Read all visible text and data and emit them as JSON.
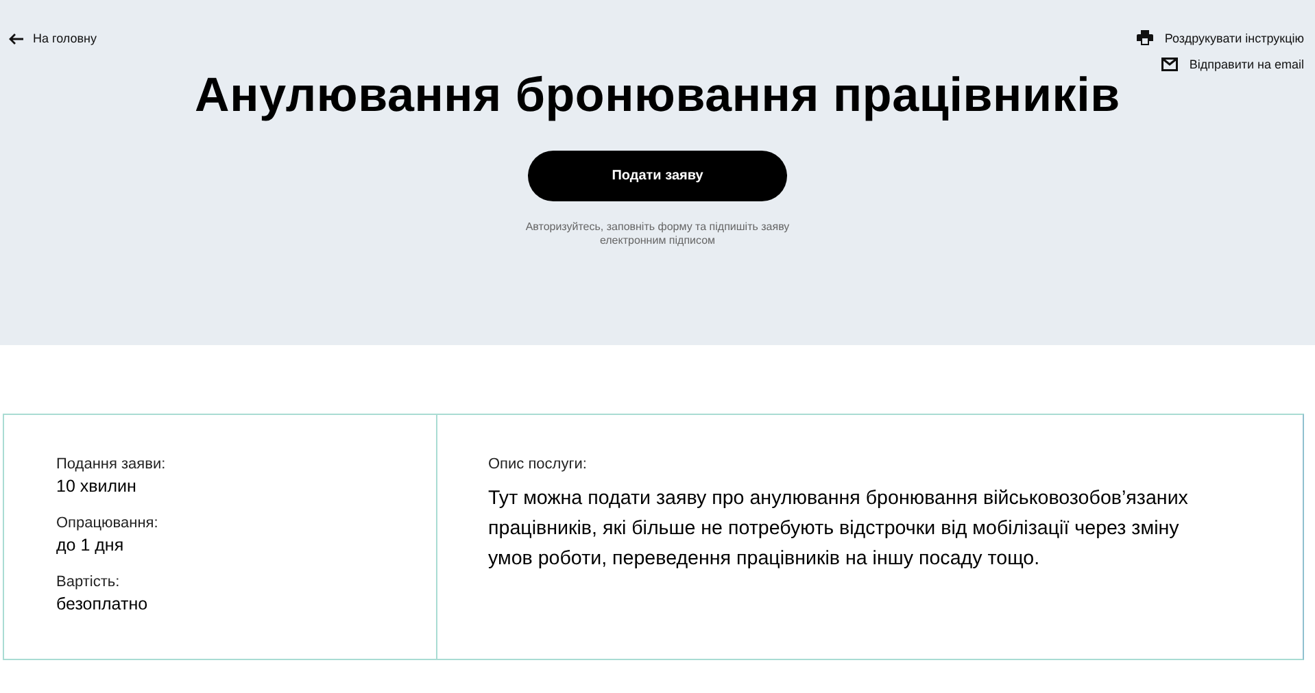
{
  "back_link": {
    "label": "На головну"
  },
  "actions": [
    {
      "kind": "print",
      "label": "Роздрукувати інструкцію"
    },
    {
      "kind": "email",
      "label": "Відправити на email"
    }
  ],
  "title": "Анулювання бронювання працівників",
  "submit_button": {
    "label": "Подати заяву"
  },
  "hint": "Авторизуйтесь, заповніть форму та підпишіть заяву електронним підписом",
  "facts": [
    {
      "label": "Подання заяви:",
      "value": "10 хвилин"
    },
    {
      "label": "Опрацювання:",
      "value": "до 1 дня"
    },
    {
      "label": "Вартість:",
      "value": "безоплатно"
    }
  ],
  "description": {
    "label": "Опис послуги:",
    "text": "Тут можна подати заяву про анулювання бронювання військовозобов’язаних працівників, які більше не потребують відстрочки від мобілізації через зміну умов роботи, переведення працівників на іншу посаду тощо."
  }
}
